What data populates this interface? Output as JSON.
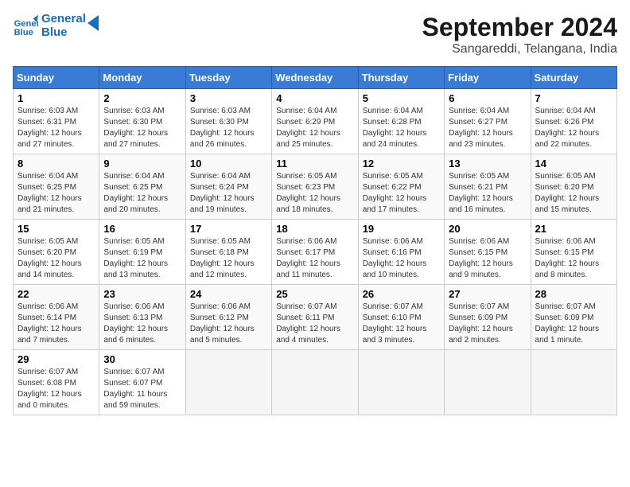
{
  "logo": {
    "line1": "General",
    "line2": "Blue"
  },
  "title": "September 2024",
  "subtitle": "Sangareddi, Telangana, India",
  "days_of_week": [
    "Sunday",
    "Monday",
    "Tuesday",
    "Wednesday",
    "Thursday",
    "Friday",
    "Saturday"
  ],
  "weeks": [
    [
      {
        "day": "1",
        "info": "Sunrise: 6:03 AM\nSunset: 6:31 PM\nDaylight: 12 hours\nand 27 minutes."
      },
      {
        "day": "2",
        "info": "Sunrise: 6:03 AM\nSunset: 6:30 PM\nDaylight: 12 hours\nand 27 minutes."
      },
      {
        "day": "3",
        "info": "Sunrise: 6:03 AM\nSunset: 6:30 PM\nDaylight: 12 hours\nand 26 minutes."
      },
      {
        "day": "4",
        "info": "Sunrise: 6:04 AM\nSunset: 6:29 PM\nDaylight: 12 hours\nand 25 minutes."
      },
      {
        "day": "5",
        "info": "Sunrise: 6:04 AM\nSunset: 6:28 PM\nDaylight: 12 hours\nand 24 minutes."
      },
      {
        "day": "6",
        "info": "Sunrise: 6:04 AM\nSunset: 6:27 PM\nDaylight: 12 hours\nand 23 minutes."
      },
      {
        "day": "7",
        "info": "Sunrise: 6:04 AM\nSunset: 6:26 PM\nDaylight: 12 hours\nand 22 minutes."
      }
    ],
    [
      {
        "day": "8",
        "info": "Sunrise: 6:04 AM\nSunset: 6:25 PM\nDaylight: 12 hours\nand 21 minutes."
      },
      {
        "day": "9",
        "info": "Sunrise: 6:04 AM\nSunset: 6:25 PM\nDaylight: 12 hours\nand 20 minutes."
      },
      {
        "day": "10",
        "info": "Sunrise: 6:04 AM\nSunset: 6:24 PM\nDaylight: 12 hours\nand 19 minutes."
      },
      {
        "day": "11",
        "info": "Sunrise: 6:05 AM\nSunset: 6:23 PM\nDaylight: 12 hours\nand 18 minutes."
      },
      {
        "day": "12",
        "info": "Sunrise: 6:05 AM\nSunset: 6:22 PM\nDaylight: 12 hours\nand 17 minutes."
      },
      {
        "day": "13",
        "info": "Sunrise: 6:05 AM\nSunset: 6:21 PM\nDaylight: 12 hours\nand 16 minutes."
      },
      {
        "day": "14",
        "info": "Sunrise: 6:05 AM\nSunset: 6:20 PM\nDaylight: 12 hours\nand 15 minutes."
      }
    ],
    [
      {
        "day": "15",
        "info": "Sunrise: 6:05 AM\nSunset: 6:20 PM\nDaylight: 12 hours\nand 14 minutes."
      },
      {
        "day": "16",
        "info": "Sunrise: 6:05 AM\nSunset: 6:19 PM\nDaylight: 12 hours\nand 13 minutes."
      },
      {
        "day": "17",
        "info": "Sunrise: 6:05 AM\nSunset: 6:18 PM\nDaylight: 12 hours\nand 12 minutes."
      },
      {
        "day": "18",
        "info": "Sunrise: 6:06 AM\nSunset: 6:17 PM\nDaylight: 12 hours\nand 11 minutes."
      },
      {
        "day": "19",
        "info": "Sunrise: 6:06 AM\nSunset: 6:16 PM\nDaylight: 12 hours\nand 10 minutes."
      },
      {
        "day": "20",
        "info": "Sunrise: 6:06 AM\nSunset: 6:15 PM\nDaylight: 12 hours\nand 9 minutes."
      },
      {
        "day": "21",
        "info": "Sunrise: 6:06 AM\nSunset: 6:15 PM\nDaylight: 12 hours\nand 8 minutes."
      }
    ],
    [
      {
        "day": "22",
        "info": "Sunrise: 6:06 AM\nSunset: 6:14 PM\nDaylight: 12 hours\nand 7 minutes."
      },
      {
        "day": "23",
        "info": "Sunrise: 6:06 AM\nSunset: 6:13 PM\nDaylight: 12 hours\nand 6 minutes."
      },
      {
        "day": "24",
        "info": "Sunrise: 6:06 AM\nSunset: 6:12 PM\nDaylight: 12 hours\nand 5 minutes."
      },
      {
        "day": "25",
        "info": "Sunrise: 6:07 AM\nSunset: 6:11 PM\nDaylight: 12 hours\nand 4 minutes."
      },
      {
        "day": "26",
        "info": "Sunrise: 6:07 AM\nSunset: 6:10 PM\nDaylight: 12 hours\nand 3 minutes."
      },
      {
        "day": "27",
        "info": "Sunrise: 6:07 AM\nSunset: 6:09 PM\nDaylight: 12 hours\nand 2 minutes."
      },
      {
        "day": "28",
        "info": "Sunrise: 6:07 AM\nSunset: 6:09 PM\nDaylight: 12 hours\nand 1 minute."
      }
    ],
    [
      {
        "day": "29",
        "info": "Sunrise: 6:07 AM\nSunset: 6:08 PM\nDaylight: 12 hours\nand 0 minutes."
      },
      {
        "day": "30",
        "info": "Sunrise: 6:07 AM\nSunset: 6:07 PM\nDaylight: 11 hours\nand 59 minutes."
      },
      {
        "day": "",
        "info": ""
      },
      {
        "day": "",
        "info": ""
      },
      {
        "day": "",
        "info": ""
      },
      {
        "day": "",
        "info": ""
      },
      {
        "day": "",
        "info": ""
      }
    ]
  ]
}
